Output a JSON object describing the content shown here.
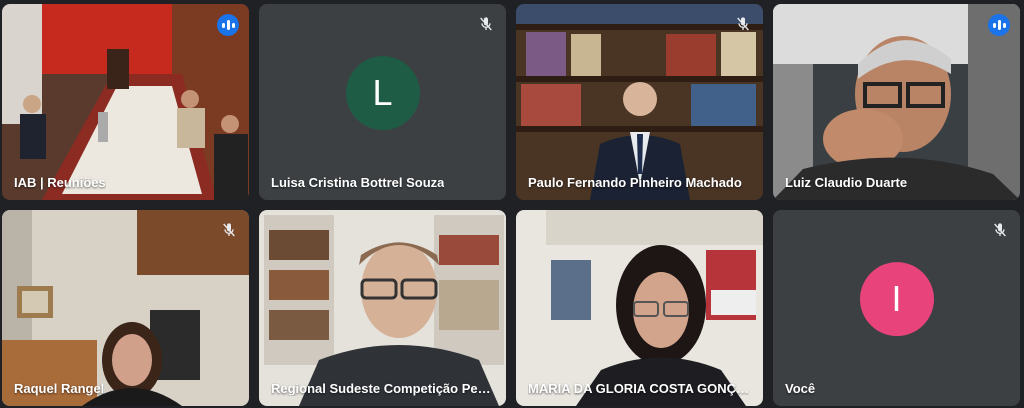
{
  "colors": {
    "background": "#202124",
    "tile": "#3c4043",
    "active_outline": "#8ab4f8",
    "speaking_badge": "#1a73e8"
  },
  "participants": [
    {
      "name": "IAB | Reuniões",
      "view": "video",
      "mic": "speaking",
      "active": false
    },
    {
      "name": "Luisa Cristina Bottrel Souza",
      "view": "avatar",
      "initial": "L",
      "avatar_color": "#1e5c45",
      "mic": "muted",
      "active": false
    },
    {
      "name": "Paulo Fernando Pinheiro Machado",
      "view": "video",
      "mic": "muted",
      "active": false
    },
    {
      "name": "Luiz Claudio Duarte",
      "view": "video",
      "mic": "speaking",
      "active": true
    },
    {
      "name": "Raquel Rangel",
      "view": "video",
      "mic": "muted",
      "active": false
    },
    {
      "name": "Regional Sudeste Competição Petrônio...",
      "view": "video",
      "mic": "none",
      "active": false
    },
    {
      "name": "MARIA DA GLORIA COSTA GONÇALVE...",
      "view": "video",
      "mic": "none",
      "active": false
    },
    {
      "name": "Você",
      "view": "avatar",
      "initial": "I",
      "avatar_color": "#e8437a",
      "mic": "muted",
      "active": false
    }
  ]
}
